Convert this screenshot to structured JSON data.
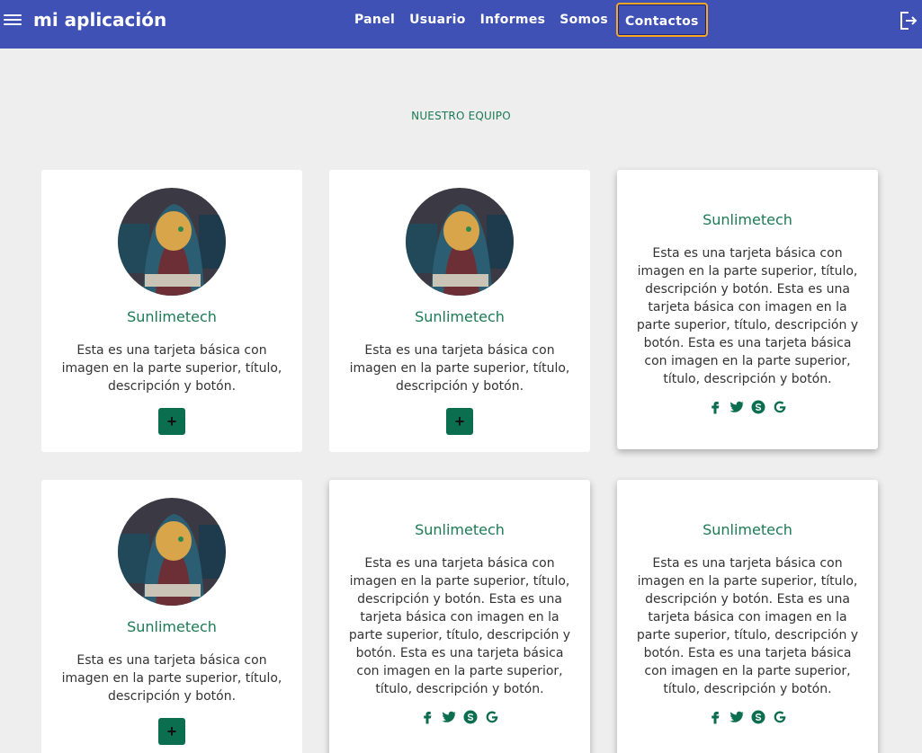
{
  "app": {
    "title": "mi aplicación"
  },
  "nav": [
    {
      "label": "Panel"
    },
    {
      "label": "Usuario"
    },
    {
      "label": "Informes"
    },
    {
      "label": "Somos"
    },
    {
      "label": "Contactos",
      "active": true
    }
  ],
  "section": {
    "title": "NUESTRO EQUIPO"
  },
  "cards": [
    {
      "name": "Sunlimetech",
      "desc": "Esta es una tarjeta básica con imagen en la parte superior, título, descripción y botón.",
      "button": "+"
    },
    {
      "name": "Sunlimetech",
      "desc": "Esta es una tarjeta básica con imagen en la parte superior, título, descripción y botón.",
      "button": "+"
    },
    {
      "name": "Sunlimetech",
      "desc": "Esta es una tarjeta básica con imagen en la parte superior, título, descripción y botón. Esta es una tarjeta básica con imagen en la parte superior, título, descripción y botón. Esta es una tarjeta básica con imagen en la parte superior, título, descripción y botón."
    },
    {
      "name": "Sunlimetech",
      "desc": "Esta es una tarjeta básica con imagen en la parte superior, título, descripción y botón.",
      "button": "+"
    },
    {
      "name": "Sunlimetech",
      "desc": "Esta es una tarjeta básica con imagen en la parte superior, título, descripción y botón. Esta es una tarjeta básica con imagen en la parte superior, título, descripción y botón. Esta es una tarjeta básica con imagen en la parte superior, título, descripción y botón."
    },
    {
      "name": "Sunlimetech",
      "desc": "Esta es una tarjeta básica con imagen en la parte superior, título, descripción y botón. Esta es una tarjeta básica con imagen en la parte superior, título, descripción y botón. Esta es una tarjeta básica con imagen en la parte superior, título, descripción y botón."
    }
  ],
  "icons": {
    "menu": "hamburger-icon",
    "logout": "logout-icon",
    "social": [
      "facebook-icon",
      "twitter-icon",
      "skype-icon",
      "google-icon"
    ]
  },
  "colors": {
    "appbar": "#3f51b5",
    "accent": "#1b7a56",
    "button": "#0b6e4f",
    "active_outline": "#f9a825",
    "background": "#eeeeee"
  }
}
